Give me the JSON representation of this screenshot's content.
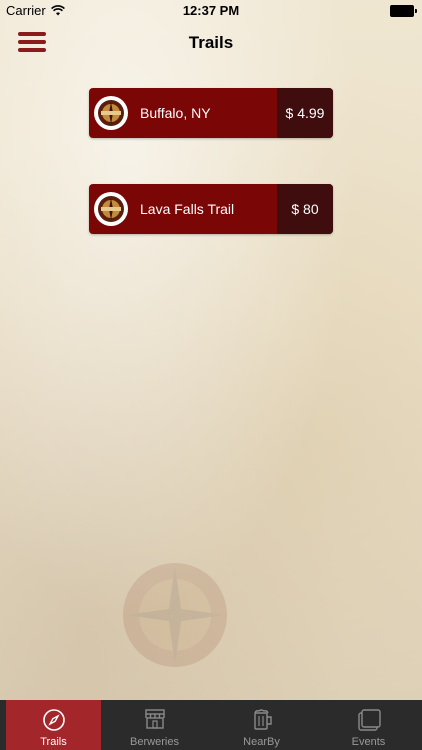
{
  "status_bar": {
    "carrier": "Carrier",
    "time": "12:37 PM"
  },
  "nav": {
    "title": "Trails"
  },
  "trails": [
    {
      "name": "Buffalo, NY",
      "price": "$ 4.99"
    },
    {
      "name": "Lava Falls Trail",
      "price": "$ 80"
    }
  ],
  "tabs": [
    {
      "label": "Trails",
      "icon": "compass-icon",
      "active": true
    },
    {
      "label": "Berweries",
      "icon": "storefront-icon",
      "active": false
    },
    {
      "label": "NearBy",
      "icon": "beer-mug-icon",
      "active": false
    },
    {
      "label": "Events",
      "icon": "calendar-icon",
      "active": false
    }
  ],
  "colors": {
    "card": "#7a0606",
    "price_block": "#3f0d0d",
    "tab_bar": "#2b2b2b",
    "tab_active": "#a3262b",
    "menu_icon": "#8b1a1a"
  }
}
